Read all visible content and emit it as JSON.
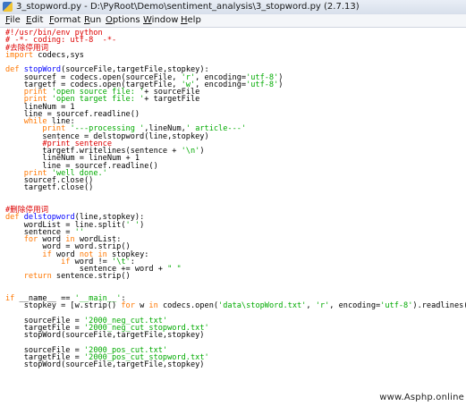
{
  "window": {
    "title": "3_stopword.py - D:\\PyRoot\\Demo\\sentiment_analysis\\3_stopword.py (2.7.13)"
  },
  "menu": [
    "File",
    "Edit",
    "Format",
    "Run",
    "Options",
    "Window",
    "Help"
  ],
  "code": [
    [
      [
        "comment",
        "#!/usr/bin/env python"
      ]
    ],
    [
      [
        "comment",
        "# -*- coding: utf-8  -*-"
      ]
    ],
    [
      [
        "comment",
        "#去除停用词"
      ]
    ],
    [
      [
        "keyword",
        "import"
      ],
      [
        "plain",
        " codecs,sys"
      ]
    ],
    [],
    [
      [
        "keyword",
        "def"
      ],
      [
        "plain",
        " "
      ],
      [
        "def",
        "stopWord"
      ],
      [
        "plain",
        "(sourceFile,targetFile,stopkey):"
      ]
    ],
    [
      [
        "plain",
        "    sourcef = codecs.open(sourceFile, "
      ],
      [
        "string",
        "'r'"
      ],
      [
        "plain",
        ", encoding="
      ],
      [
        "string",
        "'utf-8'"
      ],
      [
        "plain",
        ")"
      ]
    ],
    [
      [
        "plain",
        "    targetf = codecs.open(targetFile, "
      ],
      [
        "string",
        "'w'"
      ],
      [
        "plain",
        ", encoding="
      ],
      [
        "string",
        "'utf-8'"
      ],
      [
        "plain",
        ")"
      ]
    ],
    [
      [
        "plain",
        "    "
      ],
      [
        "keyword",
        "print"
      ],
      [
        "plain",
        " "
      ],
      [
        "string",
        "'open source file: '"
      ],
      [
        "plain",
        "+ sourceFile"
      ]
    ],
    [
      [
        "plain",
        "    "
      ],
      [
        "keyword",
        "print"
      ],
      [
        "plain",
        " "
      ],
      [
        "string",
        "'open target file: '"
      ],
      [
        "plain",
        "+ targetFile"
      ]
    ],
    [
      [
        "plain",
        "    lineNum = 1"
      ]
    ],
    [
      [
        "plain",
        "    line = sourcef.readline()"
      ]
    ],
    [
      [
        "plain",
        "    "
      ],
      [
        "keyword",
        "while"
      ],
      [
        "plain",
        " line:"
      ]
    ],
    [
      [
        "plain",
        "        "
      ],
      [
        "keyword",
        "print"
      ],
      [
        "plain",
        " "
      ],
      [
        "string",
        "'---processing '"
      ],
      [
        "plain",
        ",lineNum,"
      ],
      [
        "string",
        "' article---'"
      ]
    ],
    [
      [
        "plain",
        "        sentence = delstopword(line,stopkey)"
      ]
    ],
    [
      [
        "plain",
        "        "
      ],
      [
        "comment",
        "#print sentence"
      ]
    ],
    [
      [
        "plain",
        "        targetf.writelines(sentence + "
      ],
      [
        "string",
        "'\\n'"
      ],
      [
        "plain",
        ")"
      ]
    ],
    [
      [
        "plain",
        "        lineNum = lineNum + 1"
      ]
    ],
    [
      [
        "plain",
        "        line = sourcef.readline()"
      ]
    ],
    [
      [
        "plain",
        "    "
      ],
      [
        "keyword",
        "print"
      ],
      [
        "plain",
        " "
      ],
      [
        "string",
        "'well done.'"
      ]
    ],
    [
      [
        "plain",
        "    sourcef.close()"
      ]
    ],
    [
      [
        "plain",
        "    targetf.close()"
      ]
    ],
    [],
    [],
    [
      [
        "comment",
        "#删除停用词"
      ]
    ],
    [
      [
        "keyword",
        "def"
      ],
      [
        "plain",
        " "
      ],
      [
        "def",
        "delstopword"
      ],
      [
        "plain",
        "(line,stopkey):"
      ]
    ],
    [
      [
        "plain",
        "    wordList = line.split("
      ],
      [
        "string",
        "' '"
      ],
      [
        "plain",
        ")"
      ]
    ],
    [
      [
        "plain",
        "    sentence = "
      ],
      [
        "string",
        "''"
      ]
    ],
    [
      [
        "plain",
        "    "
      ],
      [
        "keyword",
        "for"
      ],
      [
        "plain",
        " word "
      ],
      [
        "keyword",
        "in"
      ],
      [
        "plain",
        " wordList:"
      ]
    ],
    [
      [
        "plain",
        "        word = word.strip()"
      ]
    ],
    [
      [
        "plain",
        "        "
      ],
      [
        "keyword",
        "if"
      ],
      [
        "plain",
        " word "
      ],
      [
        "keyword",
        "not in"
      ],
      [
        "plain",
        " stopkey:"
      ]
    ],
    [
      [
        "plain",
        "            "
      ],
      [
        "keyword",
        "if"
      ],
      [
        "plain",
        " word != "
      ],
      [
        "string",
        "'\\t'"
      ],
      [
        "plain",
        ":"
      ]
    ],
    [
      [
        "plain",
        "                sentence += word + "
      ],
      [
        "string",
        "\" \""
      ]
    ],
    [
      [
        "plain",
        "    "
      ],
      [
        "keyword",
        "return"
      ],
      [
        "plain",
        " sentence.strip()"
      ]
    ],
    [],
    [],
    [
      [
        "keyword",
        "if"
      ],
      [
        "plain",
        " __name__ == "
      ],
      [
        "string",
        "'__main__'"
      ],
      [
        "plain",
        ":"
      ]
    ],
    [
      [
        "plain",
        "    stopkey = [w.strip() "
      ],
      [
        "keyword",
        "for"
      ],
      [
        "plain",
        " w "
      ],
      [
        "keyword",
        "in"
      ],
      [
        "plain",
        " codecs.open("
      ],
      [
        "string",
        "'data\\stopWord.txt'"
      ],
      [
        "plain",
        ", "
      ],
      [
        "string",
        "'r'"
      ],
      [
        "plain",
        ", encoding="
      ],
      [
        "string",
        "'utf-8'"
      ],
      [
        "plain",
        ").readlines()]"
      ]
    ],
    [],
    [
      [
        "plain",
        "    sourceFile = "
      ],
      [
        "string",
        "'2000_neg_cut.txt'"
      ]
    ],
    [
      [
        "plain",
        "    targetFile = "
      ],
      [
        "string",
        "'2000_neg_cut_stopword.txt'"
      ]
    ],
    [
      [
        "plain",
        "    stopWord(sourceFile,targetFile,stopkey)"
      ]
    ],
    [],
    [
      [
        "plain",
        "    sourceFile = "
      ],
      [
        "string",
        "'2000_pos_cut.txt'"
      ]
    ],
    [
      [
        "plain",
        "    targetFile = "
      ],
      [
        "string",
        "'2000_pos_cut_stopword.txt'"
      ]
    ],
    [
      [
        "plain",
        "    stopWord(sourceFile,targetFile,stopkey)"
      ]
    ]
  ],
  "colors": {
    "comment": "#dd0000",
    "keyword": "#ff7700",
    "string": "#00aa00",
    "def": "#0000ff",
    "plain": "#000000"
  },
  "watermark": "www.Asphp.online"
}
